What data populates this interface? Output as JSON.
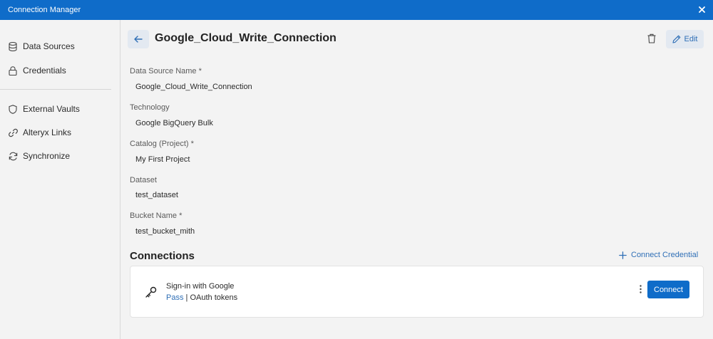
{
  "window": {
    "title": "Connection Manager"
  },
  "sidebar": {
    "items": [
      {
        "label": "Data Sources",
        "icon": "database-icon"
      },
      {
        "label": "Credentials",
        "icon": "lock-icon"
      },
      {
        "label": "External Vaults",
        "icon": "shield-icon"
      },
      {
        "label": "Alteryx Links",
        "icon": "link-icon"
      },
      {
        "label": "Synchronize",
        "icon": "sync-icon"
      }
    ]
  },
  "header": {
    "title": "Google_Cloud_Write_Connection",
    "edit_label": "Edit"
  },
  "fields": [
    {
      "label": "Data Source Name *",
      "value": "Google_Cloud_Write_Connection"
    },
    {
      "label": "Technology",
      "value": "Google BigQuery Bulk"
    },
    {
      "label": "Catalog (Project) *",
      "value": "My First Project"
    },
    {
      "label": "Dataset",
      "value": "test_dataset"
    },
    {
      "label": "Bucket Name *",
      "value": "test_bucket_mith"
    }
  ],
  "connections": {
    "heading": "Connections",
    "add_label": "Connect Credential",
    "items": [
      {
        "name": "Sign-in with Google",
        "status": "Pass",
        "separator": " | ",
        "type": "OAuth tokens",
        "button_label": "Connect"
      }
    ]
  },
  "colors": {
    "accent": "#0f6cc9",
    "link": "#2f6fb6",
    "background": "#f3f3f3"
  }
}
